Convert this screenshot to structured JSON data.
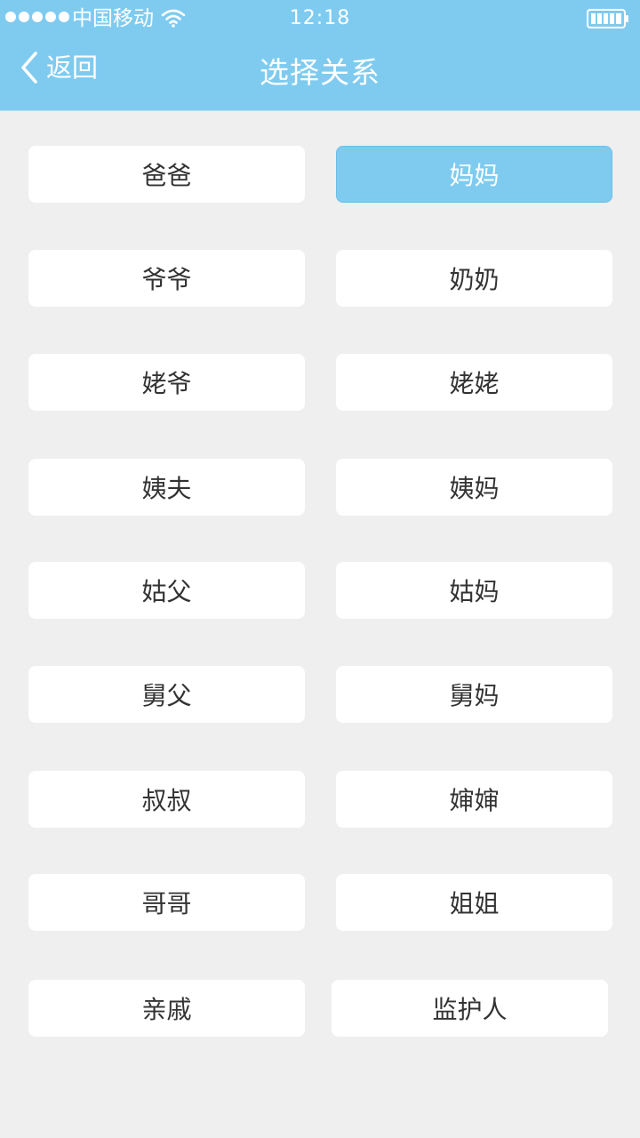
{
  "status_bar": {
    "carrier": "中国移动",
    "time": "12:18",
    "signal_icon": "signal-dots-icon",
    "wifi_icon": "wifi-icon",
    "battery_icon": "battery-icon"
  },
  "nav": {
    "back_label": "返回",
    "back_icon": "chevron-left-icon",
    "title": "选择关系"
  },
  "colors": {
    "accent": "#7fcbf0",
    "background": "#efefef",
    "card": "#ffffff",
    "text": "#333333"
  },
  "relations": {
    "selected": "妈妈",
    "items": [
      {
        "label": "爸爸"
      },
      {
        "label": "妈妈"
      },
      {
        "label": "爷爷"
      },
      {
        "label": "奶奶"
      },
      {
        "label": "姥爷"
      },
      {
        "label": "姥姥"
      },
      {
        "label": "姨夫"
      },
      {
        "label": "姨妈"
      },
      {
        "label": "姑父"
      },
      {
        "label": "姑妈"
      },
      {
        "label": "舅父"
      },
      {
        "label": "舅妈"
      },
      {
        "label": "叔叔"
      },
      {
        "label": "婶婶"
      },
      {
        "label": "哥哥"
      },
      {
        "label": "姐姐"
      },
      {
        "label": "亲戚"
      },
      {
        "label": "监护人"
      }
    ]
  }
}
